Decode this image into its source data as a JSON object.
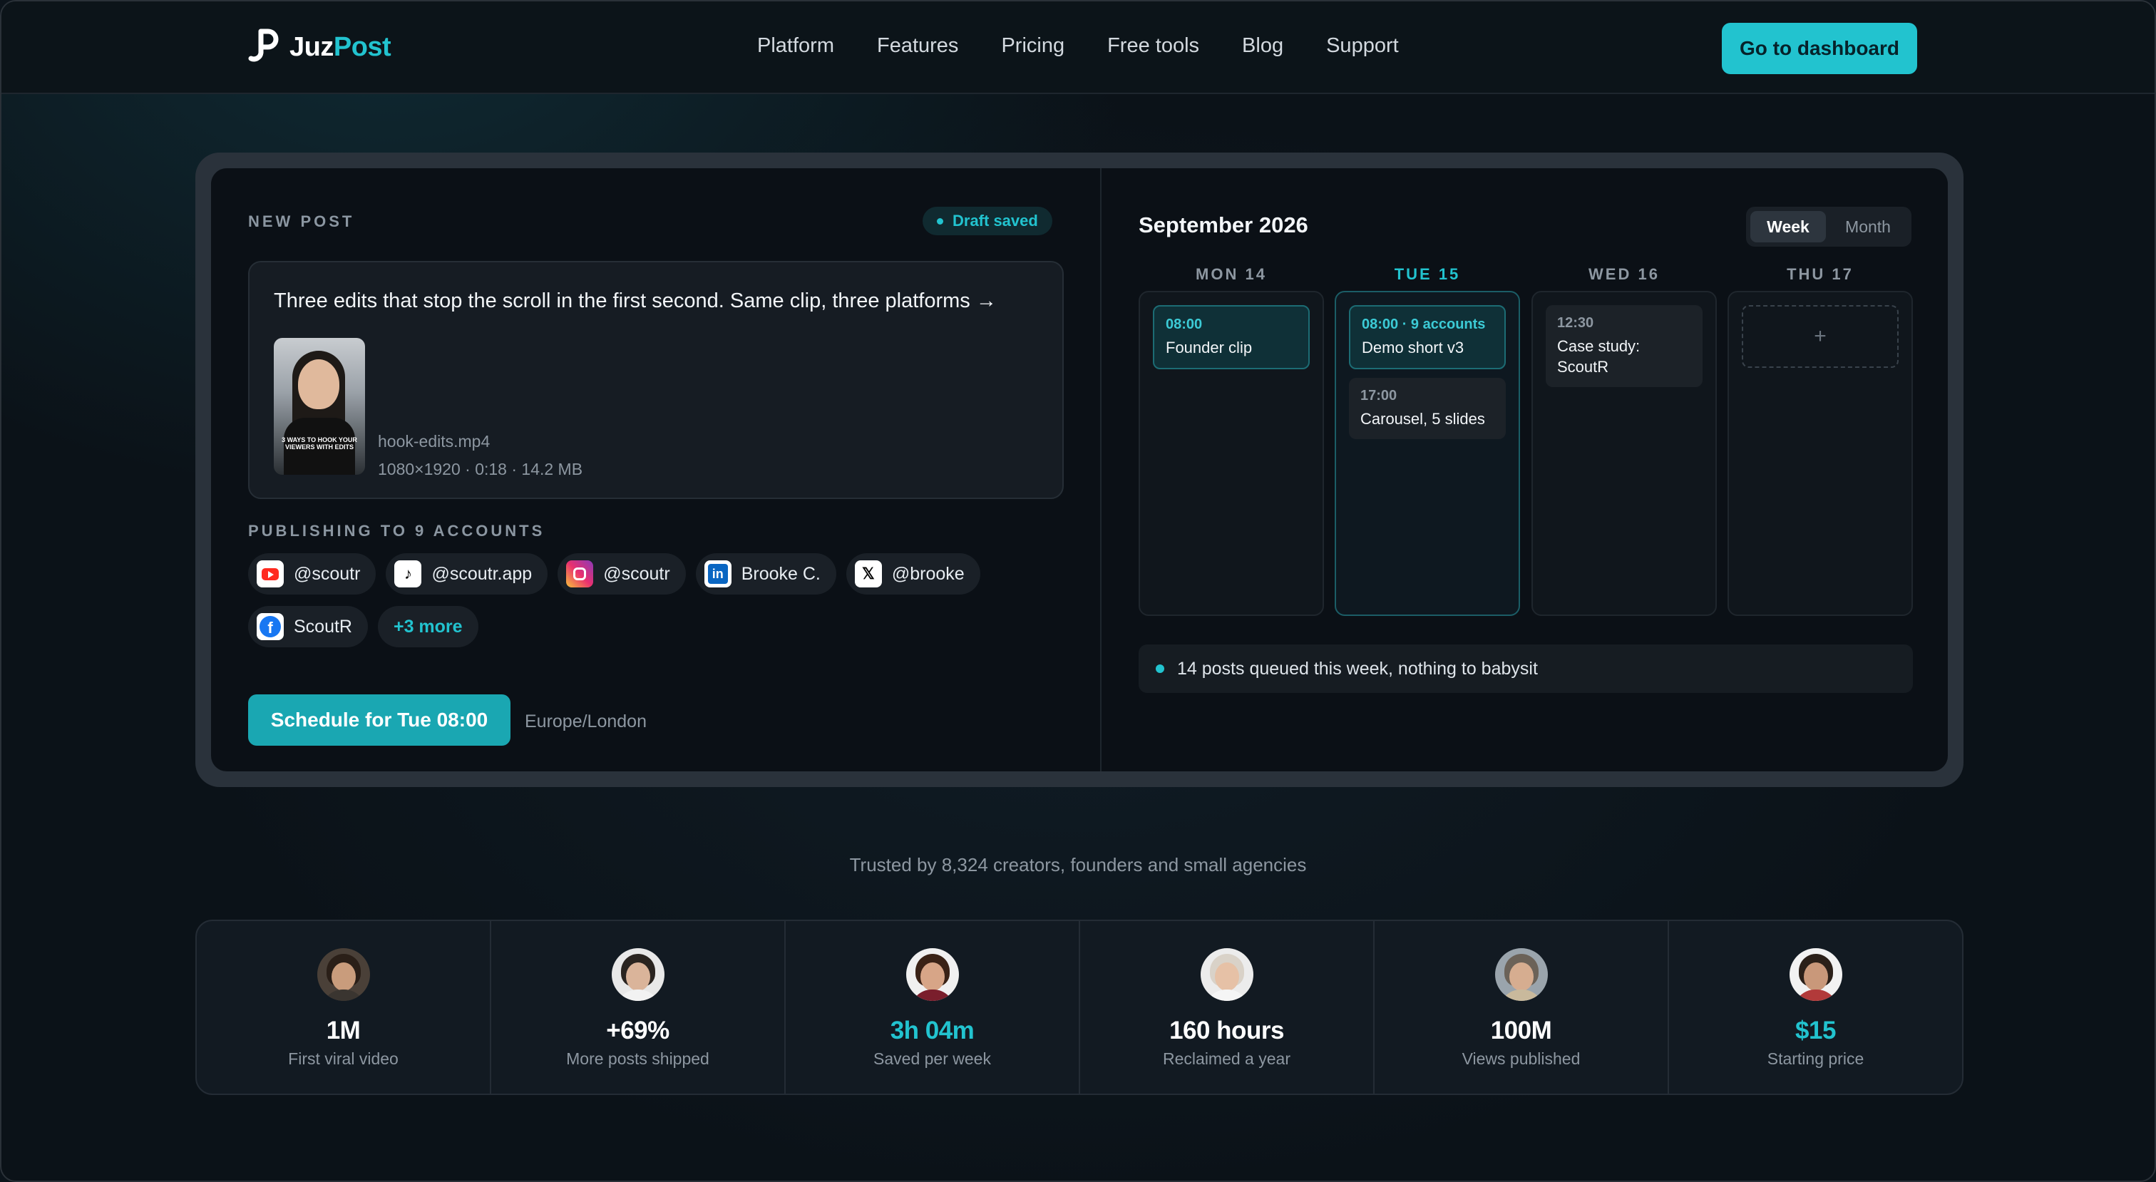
{
  "brand": {
    "name_part1": "Juz",
    "name_part2": "Post",
    "accent": "#22c3cf"
  },
  "nav": {
    "links": [
      "Platform",
      "Features",
      "Pricing",
      "Free tools",
      "Blog",
      "Support"
    ],
    "cta": "Go to dashboard"
  },
  "composer": {
    "section_label": "NEW POST",
    "draft_status": "Draft saved",
    "text": "Three edits that stop the scroll in the first second. Same clip, three platforms →",
    "thumbnail_caption": "3 WAYS TO HOOK YOUR VIEWERS WITH EDITS",
    "file_name": "hook-edits.mp4",
    "file_meta": "1080×1920 · 0:18 · 14.2 MB",
    "publish_label": "PUBLISHING TO 9 ACCOUNTS",
    "accounts": [
      {
        "handle": "@scoutr",
        "icon": "youtube-icon"
      },
      {
        "handle": "@scoutr.app",
        "icon": "tiktok-icon"
      },
      {
        "handle": "@scoutr",
        "icon": "instagram-icon"
      },
      {
        "handle": "Brooke C.",
        "icon": "linkedin-icon"
      },
      {
        "handle": "@brooke",
        "icon": "x-icon"
      },
      {
        "handle": "ScoutR",
        "icon": "facebook-icon"
      }
    ],
    "more_accounts": "+3 more",
    "schedule_button": "Schedule for Tue 08:00",
    "timezone": "Europe/London"
  },
  "calendar": {
    "title": "September 2026",
    "view_week": "Week",
    "view_month": "Month",
    "days": [
      {
        "label": "MON 14",
        "events": [
          {
            "time": "08:00",
            "title": "Founder clip"
          }
        ]
      },
      {
        "label": "TUE 15",
        "events": [
          {
            "time": "08:00 · 9 accounts",
            "title": "Demo short v3"
          },
          {
            "time": "17:00",
            "title": "Carousel, 5 slides"
          }
        ]
      },
      {
        "label": "WED 16",
        "events": [
          {
            "time": "12:30",
            "title": "Case study: ScoutR"
          }
        ]
      },
      {
        "label": "THU 17",
        "add": "+"
      }
    ],
    "queue_note": "14 posts queued this week, nothing to babysit"
  },
  "trust_line": "Trusted by 8,324 creators, founders and small agencies",
  "stats": [
    {
      "value": "1M",
      "label": "First viral video"
    },
    {
      "value": "+69%",
      "label": "More posts shipped"
    },
    {
      "value": "3h 04m",
      "label": "Saved per week"
    },
    {
      "value": "160 hours",
      "label": "Reclaimed a year"
    },
    {
      "value": "100M",
      "label": "Views published"
    },
    {
      "value": "$15",
      "label": "Starting price"
    }
  ]
}
